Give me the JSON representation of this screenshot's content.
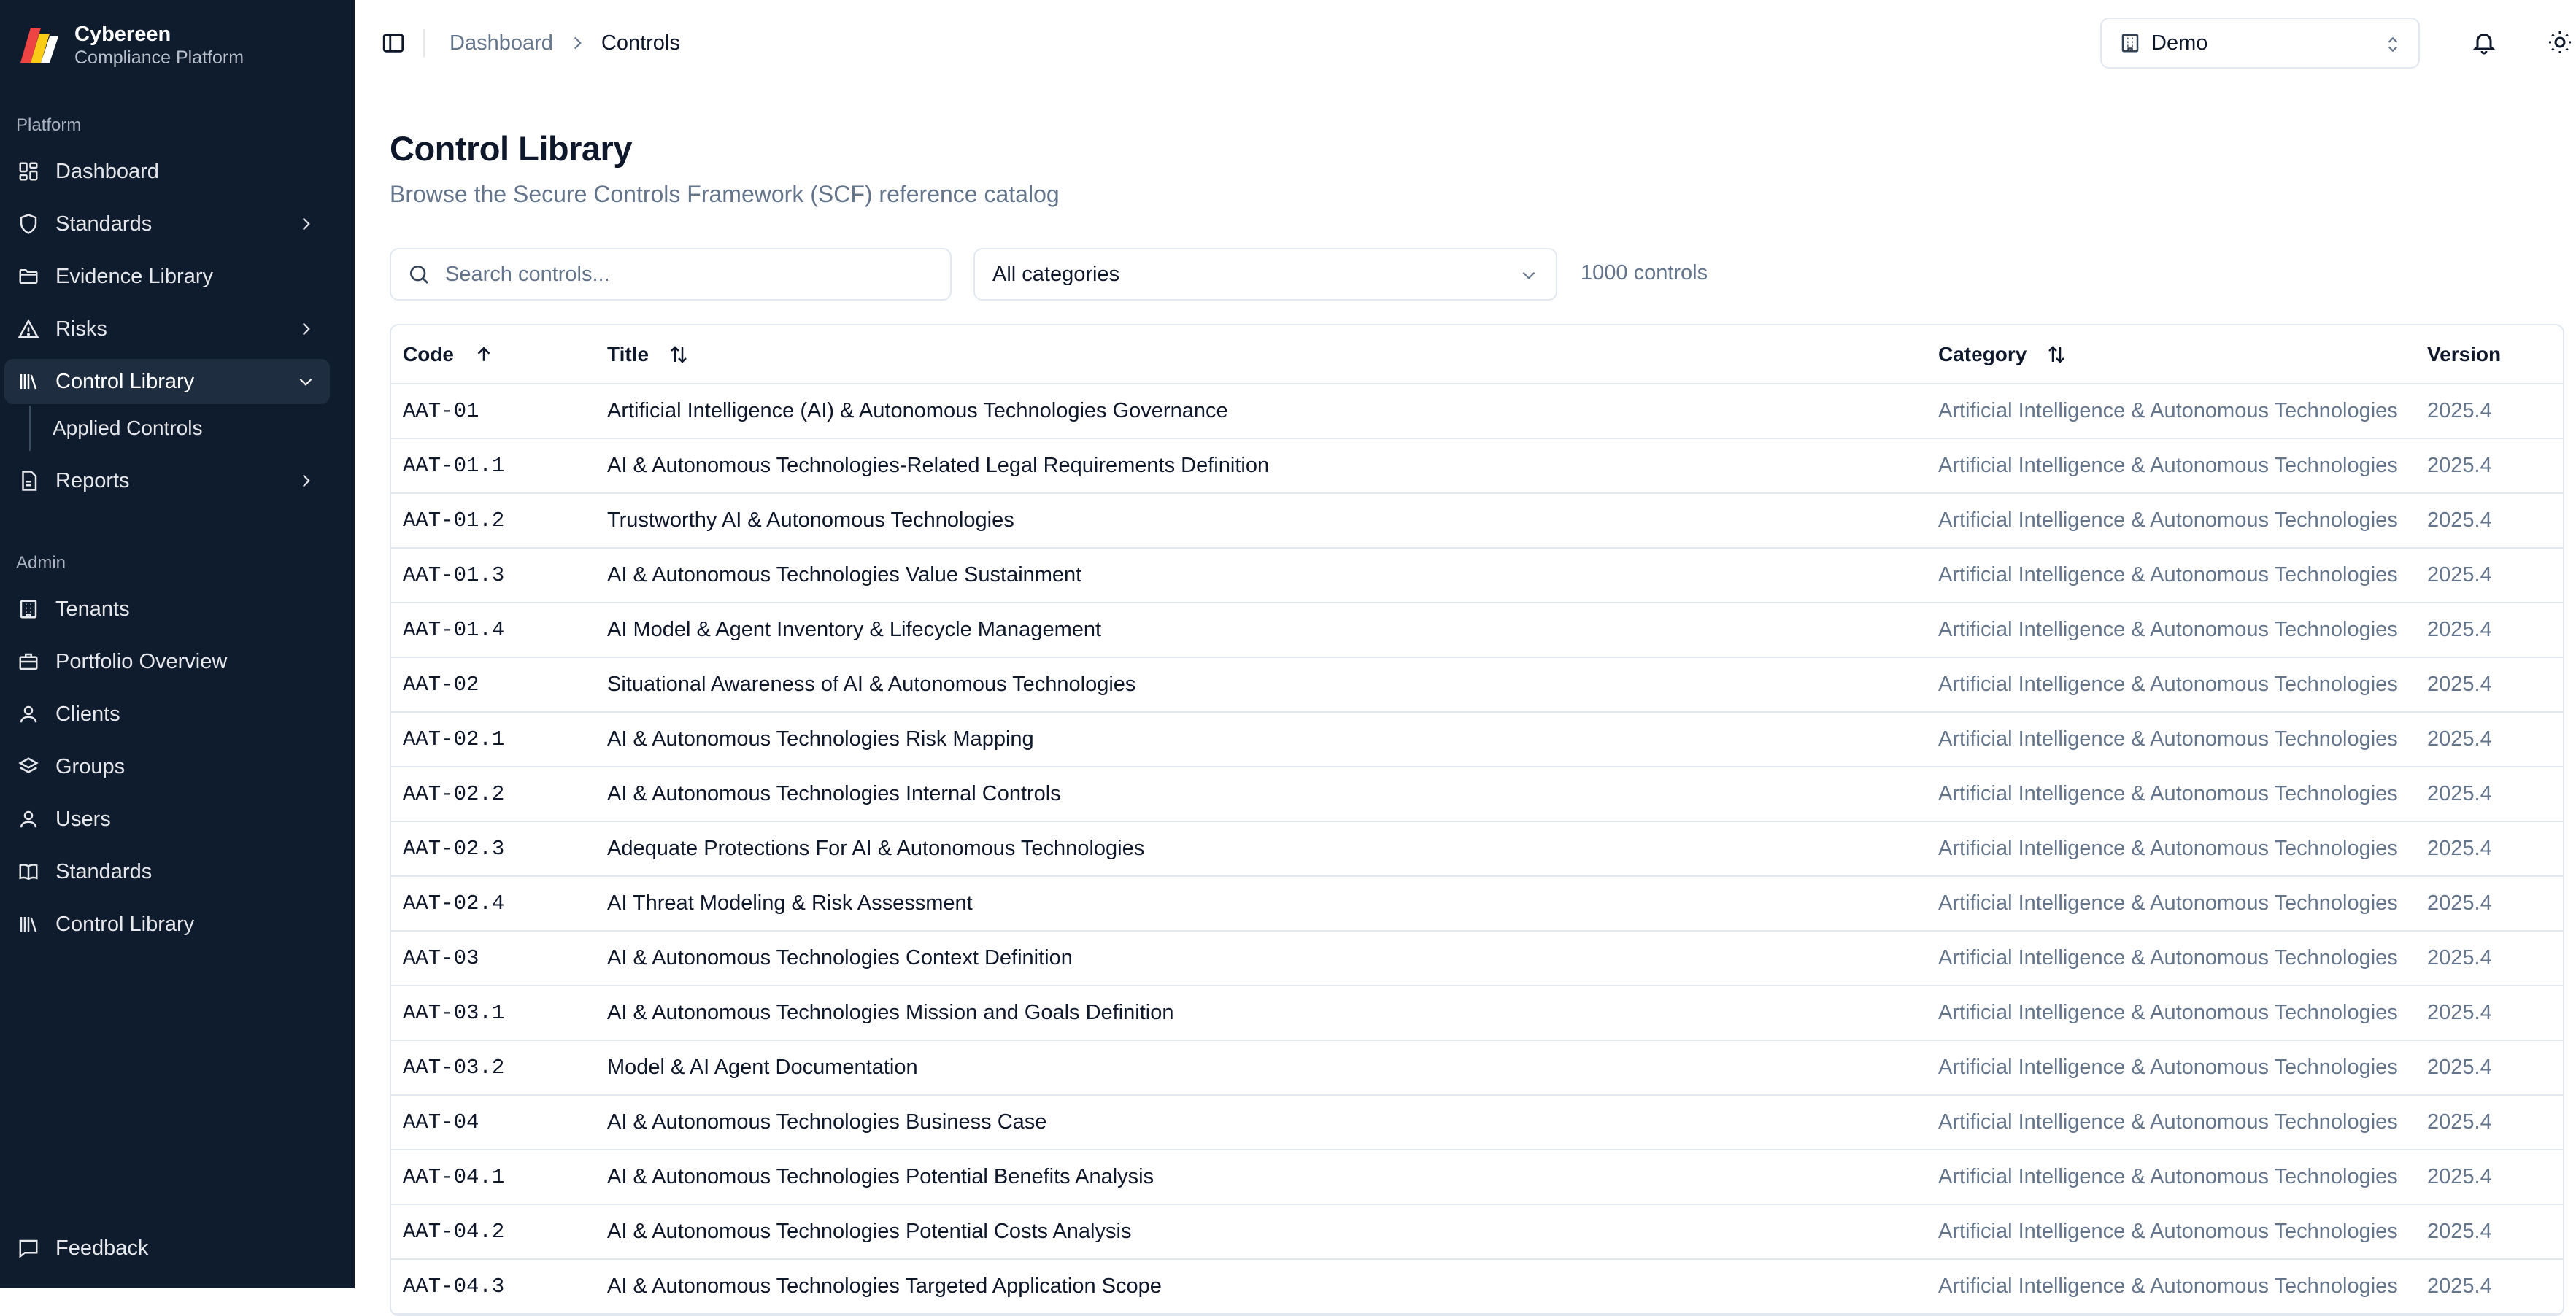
{
  "brand": {
    "name": "Cybereen",
    "subtitle": "Compliance Platform"
  },
  "nav": {
    "platform_label": "Platform",
    "admin_label": "Admin",
    "platform_items": [
      {
        "label": "Dashboard",
        "icon": "dashboard-icon"
      },
      {
        "label": "Standards",
        "icon": "shield-icon",
        "has_chevron": true
      },
      {
        "label": "Evidence Library",
        "icon": "folder-icon"
      },
      {
        "label": "Risks",
        "icon": "warning-icon",
        "has_chevron": true
      },
      {
        "label": "Control Library",
        "icon": "library-icon",
        "expanded": true,
        "active": true
      },
      {
        "label": "Reports",
        "icon": "report-icon",
        "has_chevron": true
      }
    ],
    "subitem": "Applied Controls",
    "admin_items": [
      {
        "label": "Tenants",
        "icon": "building-icon"
      },
      {
        "label": "Portfolio Overview",
        "icon": "briefcase-icon"
      },
      {
        "label": "Clients",
        "icon": "user-icon"
      },
      {
        "label": "Groups",
        "icon": "layers-icon"
      },
      {
        "label": "Users",
        "icon": "user-icon"
      },
      {
        "label": "Standards",
        "icon": "book-icon"
      },
      {
        "label": "Control Library",
        "icon": "library-icon"
      }
    ],
    "feedback": "Feedback"
  },
  "header": {
    "breadcrumb": [
      "Dashboard",
      "Controls"
    ],
    "tenant": "Demo"
  },
  "page": {
    "title": "Control Library",
    "subtitle": "Browse the Secure Controls Framework (SCF) reference catalog"
  },
  "filters": {
    "search_placeholder": "Search controls...",
    "category": "All categories",
    "count": "1000 controls"
  },
  "table": {
    "columns": [
      "Code",
      "Title",
      "Category",
      "Version"
    ],
    "rows": [
      {
        "code": "AAT-01",
        "title": "Artificial Intelligence (AI) & Autonomous Technologies Governance",
        "category": "Artificial Intelligence & Autonomous Technologies",
        "version": "2025.4"
      },
      {
        "code": "AAT-01.1",
        "title": "AI & Autonomous Technologies-Related Legal Requirements Definition",
        "category": "Artificial Intelligence & Autonomous Technologies",
        "version": "2025.4"
      },
      {
        "code": "AAT-01.2",
        "title": "Trustworthy AI & Autonomous Technologies",
        "category": "Artificial Intelligence & Autonomous Technologies",
        "version": "2025.4"
      },
      {
        "code": "AAT-01.3",
        "title": "AI & Autonomous Technologies Value Sustainment",
        "category": "Artificial Intelligence & Autonomous Technologies",
        "version": "2025.4"
      },
      {
        "code": "AAT-01.4",
        "title": "AI Model & Agent Inventory & Lifecycle Management",
        "category": "Artificial Intelligence & Autonomous Technologies",
        "version": "2025.4"
      },
      {
        "code": "AAT-02",
        "title": "Situational Awareness of AI & Autonomous Technologies",
        "category": "Artificial Intelligence & Autonomous Technologies",
        "version": "2025.4"
      },
      {
        "code": "AAT-02.1",
        "title": "AI & Autonomous Technologies Risk Mapping",
        "category": "Artificial Intelligence & Autonomous Technologies",
        "version": "2025.4"
      },
      {
        "code": "AAT-02.2",
        "title": "AI & Autonomous Technologies Internal Controls",
        "category": "Artificial Intelligence & Autonomous Technologies",
        "version": "2025.4"
      },
      {
        "code": "AAT-02.3",
        "title": "Adequate Protections For AI & Autonomous Technologies",
        "category": "Artificial Intelligence & Autonomous Technologies",
        "version": "2025.4"
      },
      {
        "code": "AAT-02.4",
        "title": "AI Threat Modeling & Risk Assessment",
        "category": "Artificial Intelligence & Autonomous Technologies",
        "version": "2025.4"
      },
      {
        "code": "AAT-03",
        "title": "AI & Autonomous Technologies Context Definition",
        "category": "Artificial Intelligence & Autonomous Technologies",
        "version": "2025.4"
      },
      {
        "code": "AAT-03.1",
        "title": "AI & Autonomous Technologies Mission and Goals Definition",
        "category": "Artificial Intelligence & Autonomous Technologies",
        "version": "2025.4"
      },
      {
        "code": "AAT-03.2",
        "title": "Model & AI Agent Documentation",
        "category": "Artificial Intelligence & Autonomous Technologies",
        "version": "2025.4"
      },
      {
        "code": "AAT-04",
        "title": "AI & Autonomous Technologies Business Case",
        "category": "Artificial Intelligence & Autonomous Technologies",
        "version": "2025.4"
      },
      {
        "code": "AAT-04.1",
        "title": "AI & Autonomous Technologies Potential Benefits Analysis",
        "category": "Artificial Intelligence & Autonomous Technologies",
        "version": "2025.4"
      },
      {
        "code": "AAT-04.2",
        "title": "AI & Autonomous Technologies Potential Costs Analysis",
        "category": "Artificial Intelligence & Autonomous Technologies",
        "version": "2025.4"
      },
      {
        "code": "AAT-04.3",
        "title": "AI & Autonomous Technologies Targeted Application Scope",
        "category": "Artificial Intelligence & Autonomous Technologies",
        "version": "2025.4"
      }
    ]
  },
  "colors": {
    "sidebar": "#0f1c2e",
    "accent": "#0f172a",
    "muted": "#64748b",
    "border": "#e2e8f0"
  }
}
